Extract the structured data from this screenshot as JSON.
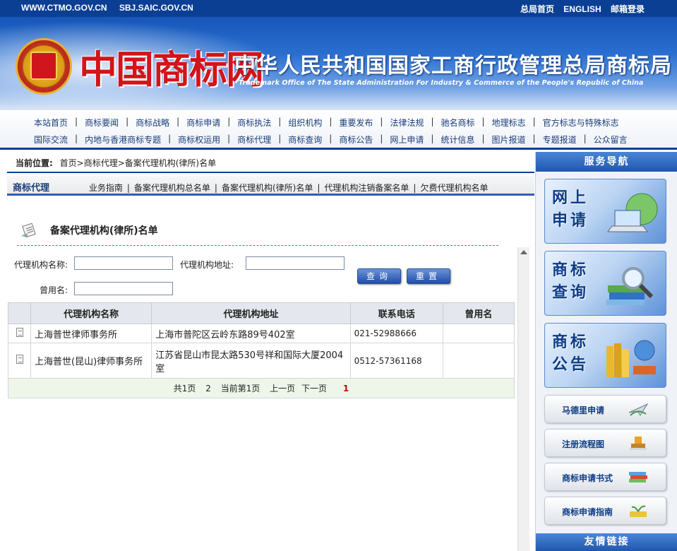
{
  "topbar": {
    "site1": "WWW.CTMO.GOV.CN",
    "site2": "SBJ.SAIC.GOV.CN",
    "links": [
      "总局首页",
      "ENGLISH",
      "邮箱登录"
    ]
  },
  "banner": {
    "logo_text": "中国商标网",
    "title_cn": "中华人民共和国国家工商行政管理总局商标局",
    "title_en": "Trademark Office of The State Administration For Industry & Commerce of the People's Republic of China"
  },
  "nav": {
    "row1": [
      "本站首页",
      "商标要闻",
      "商标战略",
      "商标申请",
      "商标执法",
      "组织机构",
      "重要发布",
      "法律法规",
      "驰名商标",
      "地理标志",
      "官方标志与特殊标志"
    ],
    "row2": [
      "国际交流",
      "内地与香港商标专题",
      "商标权运用",
      "商标代理",
      "商标查询",
      "商标公告",
      "网上申请",
      "统计信息",
      "图片报道",
      "专题报道",
      "公众留言"
    ]
  },
  "location": {
    "label": "当前位置:",
    "path": "首页>商标代理>备案代理机构(律所)名单"
  },
  "subnav": {
    "heading": "商标代理",
    "items": [
      "业务指南",
      "备案代理机构总名单",
      "备案代理机构(律所)名单",
      "代理机构注销备案名单",
      "欠费代理机构名单"
    ]
  },
  "page": {
    "title": "备案代理机构(律所)名单"
  },
  "form": {
    "name_label": "代理机构名称:",
    "name_value": "",
    "address_label": "代理机构地址:",
    "address_value": "",
    "former_label": "曾用名:",
    "former_value": "",
    "query_btn": "查询",
    "reset_btn": "重置"
  },
  "table": {
    "headers": [
      "代理机构名称",
      "代理机构地址",
      "联系电话",
      "曾用名"
    ],
    "rows": [
      {
        "name": "上海普世律师事务所",
        "address": "上海市普陀区云岭东路89号402室",
        "phone": "021-52988666",
        "former": ""
      },
      {
        "name": "上海普世(昆山)律师事务所",
        "address": "江苏省昆山市昆太路530号祥和国际大厦2004室",
        "phone": "0512-57361168",
        "former": ""
      }
    ]
  },
  "pager": {
    "total_pages": "共1页",
    "count": "2",
    "current": "当前第1页",
    "prev": "上一页",
    "next": "下一页",
    "page_num": "1"
  },
  "sidebar": {
    "header": "服务导航",
    "cards": [
      "网上申请",
      "商标查询",
      "商标公告"
    ],
    "buttons": [
      "马德里申请",
      "注册流程图",
      "商标申请书式",
      "商标申请指南"
    ],
    "footer": "友情链接"
  },
  "colors": {
    "brand_blue": "#0b3f93",
    "logo_red": "#d2141b",
    "pager_red": "#b51010"
  }
}
